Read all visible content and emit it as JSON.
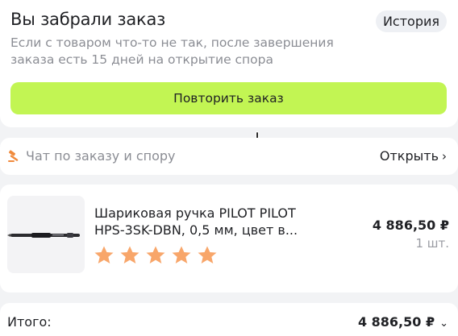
{
  "order": {
    "title": "Вы забрали заказ",
    "history_label": "История",
    "subtitle": "Если с товаром что-то не так, после завершения заказа есть 15 дней на открытие спора",
    "repeat_label": "Повторить заказ"
  },
  "chat": {
    "label": "Чат по заказу и спору",
    "open_label": "Открыть",
    "icon": "hammer-icon",
    "icon_color": "#f08a3c"
  },
  "product": {
    "name": "Шариковая ручка PILOT PILOT HPS-3SK-DBN, 0,5 мм, цвет в...",
    "price": "4 886,50 ₽",
    "quantity": "1 шт.",
    "rating": 5,
    "rating_max": 5,
    "star_color": "#f8a66a"
  },
  "total": {
    "label": "Итого:",
    "value": "4 886,50 ₽"
  },
  "colors": {
    "accent": "#c2f553",
    "background": "#f2f3f5"
  }
}
